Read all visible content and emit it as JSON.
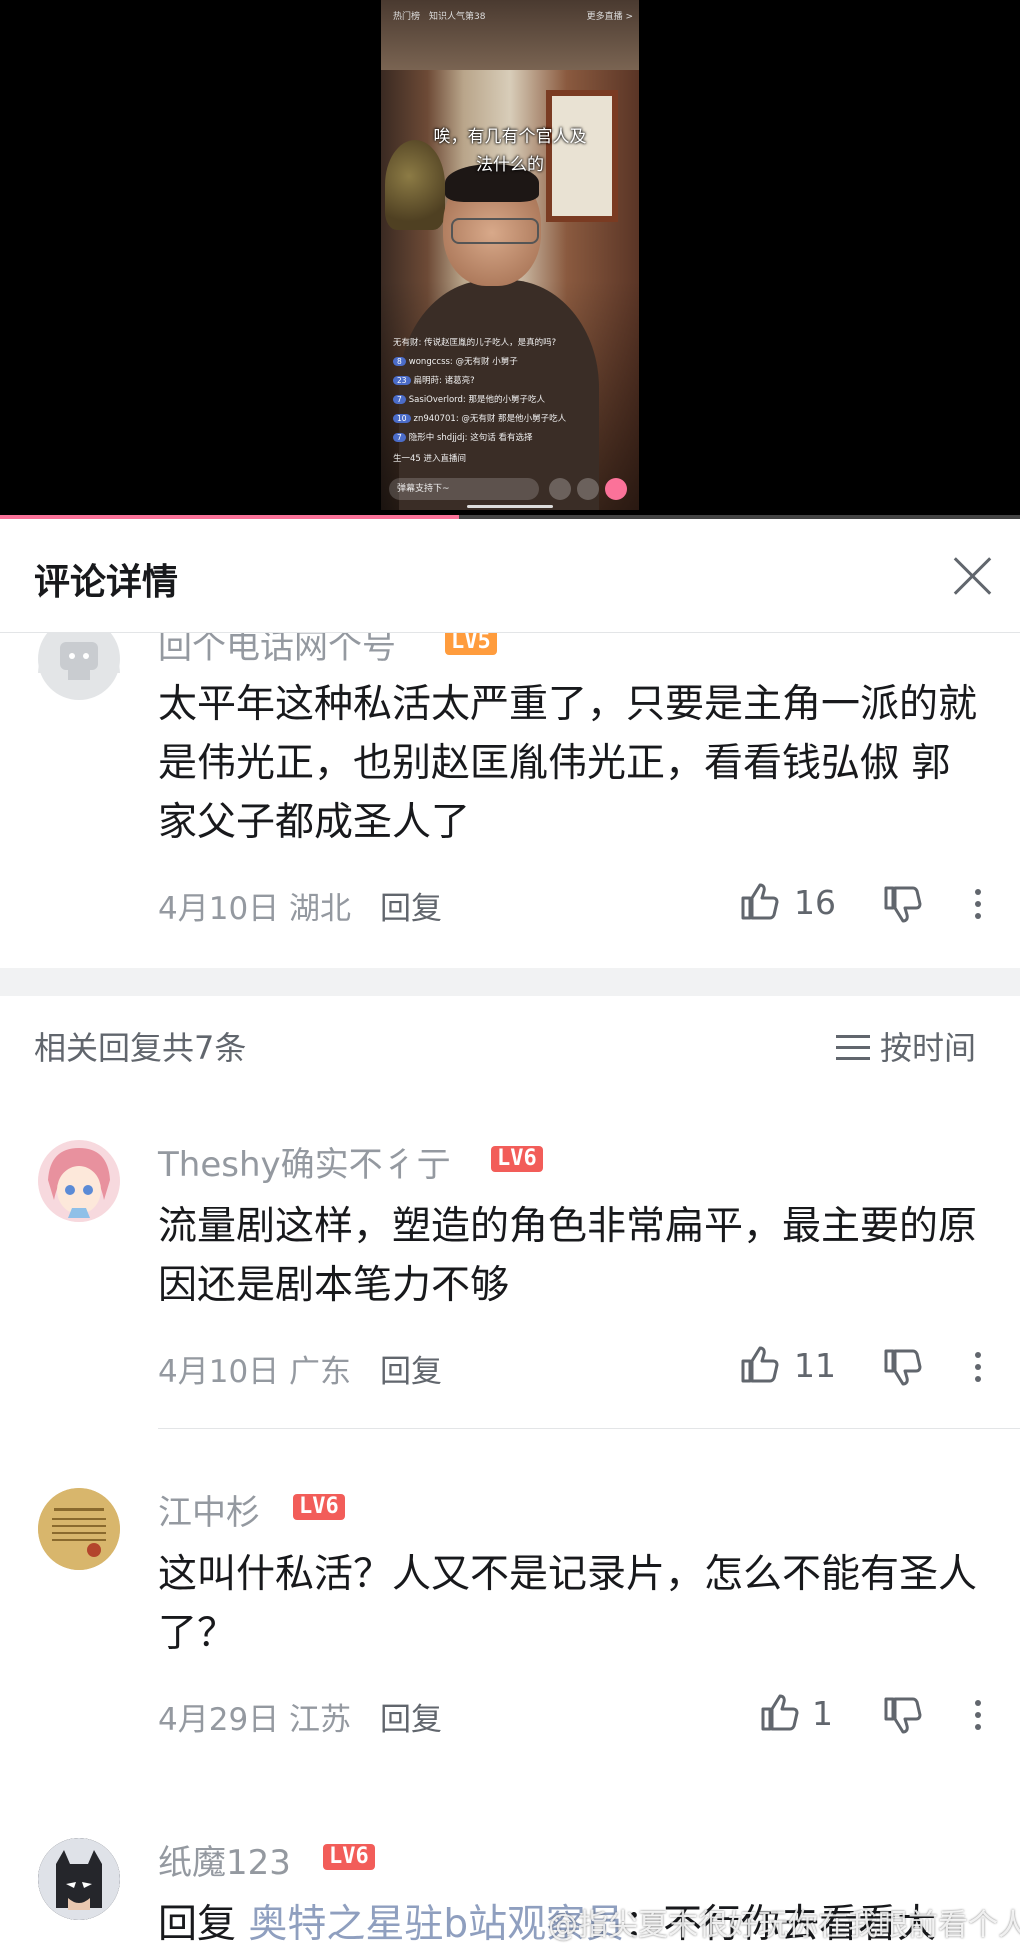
{
  "video": {
    "top_left_tag": "热门榜",
    "top_tag": "知识人气第38",
    "more_live": "更多直播 >",
    "caption_line1": "唉，有几有个官人及",
    "caption_line2": "法什么的",
    "chat": [
      {
        "text": "无有财: 传说赵匡胤的儿子吃人，是真的吗?"
      },
      {
        "badge": "8",
        "text": "wongccss: @无有财 小舅子"
      },
      {
        "badge": "23",
        "text": "扁明莳: 诸葛亮?"
      },
      {
        "badge": "7",
        "text": "SasiOverlord: 那是他的小舅子吃人"
      },
      {
        "badge": "10",
        "text": "zn940701: @无有财 那是他小舅子吃人"
      },
      {
        "badge": "7",
        "text": "隐形中 shdjjdj: 这句话 看有选择"
      },
      {
        "text": "生一45 进入直播间"
      }
    ],
    "input_placeholder": "弹幕支持下~",
    "progress": 0.45
  },
  "header": {
    "title": "评论详情"
  },
  "root_comment": {
    "username": "回个电话网个号",
    "level": "LV5",
    "content": "太平年这种私活太严重了，只要是主角一派的就是伟光正，也别赵匡胤伟光正，看看钱弘俶  郭家父子都成圣人了",
    "date": "4月10日",
    "location": "湖北",
    "reply_label": "回复",
    "likes": "16"
  },
  "replies_header": {
    "count_text": "相关回复共7条",
    "sort_label": "按时间"
  },
  "replies": [
    {
      "username": "Theshy确实不彳亍",
      "level": "LV6",
      "content": "流量剧这样，塑造的角色非常扁平，最主要的原因还是剧本笔力不够",
      "date": "4月10日",
      "location": "广东",
      "reply_label": "回复",
      "likes": "11"
    },
    {
      "username": "江中杉",
      "level": "LV6",
      "content": "这叫什私活？人又不是记录片，怎么不能有圣人了？",
      "date": "4月29日",
      "location": "江苏",
      "reply_label": "回复",
      "likes": "1"
    },
    {
      "username": "纸魔123",
      "level": "LV6",
      "content_prefix": "回复 ",
      "reply_target": "奥特之星驻b站观察员",
      "content_suffix": "：不行你去看看大"
    }
  ],
  "watermark": "@指尖夏末很好玩你在我眼前看个人"
}
